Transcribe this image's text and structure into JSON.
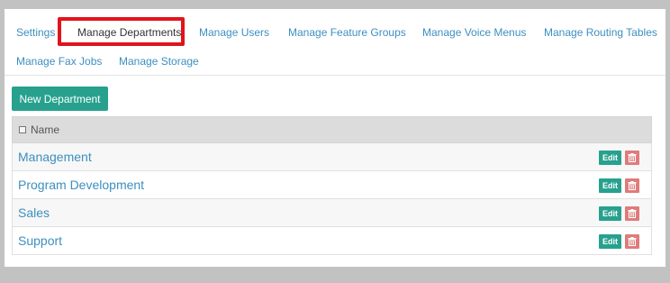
{
  "nav": {
    "tabs": [
      {
        "label": "Settings",
        "active": false
      },
      {
        "label": "Manage Departments",
        "active": true
      },
      {
        "label": "Manage Users",
        "active": false
      },
      {
        "label": "Manage Feature Groups",
        "active": false
      },
      {
        "label": "Manage Voice Menus",
        "active": false
      },
      {
        "label": "Manage Routing Tables",
        "active": false
      },
      {
        "label": "Manage Fax Jobs",
        "active": false
      },
      {
        "label": "Manage Storage",
        "active": false
      }
    ]
  },
  "toolbar": {
    "new_department_label": "New Department"
  },
  "table": {
    "header": {
      "name_label": "Name"
    },
    "rows": [
      {
        "name": "Management",
        "edit_label": "Edit"
      },
      {
        "name": "Program Development",
        "edit_label": "Edit"
      },
      {
        "name": "Sales",
        "edit_label": "Edit"
      },
      {
        "name": "Support",
        "edit_label": "Edit"
      }
    ]
  },
  "icons": {
    "delete": "trash-icon",
    "select_all": "checkbox-icon"
  },
  "colors": {
    "accent": "#27a18e",
    "link": "#3d8fc0",
    "highlight": "#e0141b",
    "delete": "#e07b7b",
    "header_bg": "#dcdcdc"
  }
}
